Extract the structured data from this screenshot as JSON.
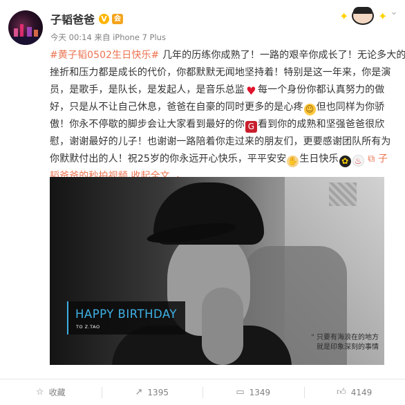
{
  "post": {
    "author": "子韬爸爸",
    "verified_mark": "V",
    "vip_mark": "会",
    "meta": "今天 00:14 来自 iPhone 7 Plus",
    "text": {
      "hashtag": "#黄子韬0502生日快乐#",
      "l1_rest": " 几年的历练你成熟了！一路的艰辛你成长了！无论多大的",
      "l2": "挫折和压力都是成长的代价，你都默默无闻地坚持着！特别是这一年来，你是演",
      "l3": "员，是歌手，是队长，是发起人，是音乐总监",
      "l3_b": "每一个身份你都认真努力的做",
      "l4_a": "好，只是从不让自己休息，爸爸在自豪的同时更多的是心疼",
      "l4_b": "但也同样为你骄",
      "l5_a": "傲！你永不停歇的脚步会让大家看到最好的你",
      "l5_b": "看到你的成熟和坚强爸爸很欣",
      "l6": "慰，谢谢最好的儿子！也谢谢一路陪着你走过来的朋友们，更要感谢团队所有为",
      "l7_a": "你默默付出的人！祝25岁的你永远开心快乐，平平安安",
      "l7_b": "生日快乐",
      "l7_link": "子",
      "l8_link": "韬爸爸的秒拍视频",
      "collapse": "收起全文"
    },
    "emoji": {
      "heart": "♥",
      "face": "☺",
      "gift": "G",
      "pray": "✋",
      "flower": "✿",
      "cake": "♨"
    },
    "video": {
      "title": "HAPPY BIRTHDAY",
      "subtitle": "TO Z.TAO",
      "quote_1": "\" 只要有海浪在的地方",
      "quote_2": "就是印象深刻的事情"
    }
  },
  "actions": {
    "favorite": "收藏",
    "repost": "1395",
    "comment": "1349",
    "like": "4149"
  },
  "icons": {
    "favorite": "star-outline-icon",
    "repost": "repost-icon",
    "comment": "comment-icon",
    "like": "thumbs-up-icon",
    "dropdown": "chevron-down-icon",
    "video_link": "video-link-icon",
    "collapse": "chevron-up-icon"
  },
  "colors": {
    "link": "#eb7350",
    "birthday_accent": "#3fb1e6",
    "verified": "#ffb400"
  }
}
